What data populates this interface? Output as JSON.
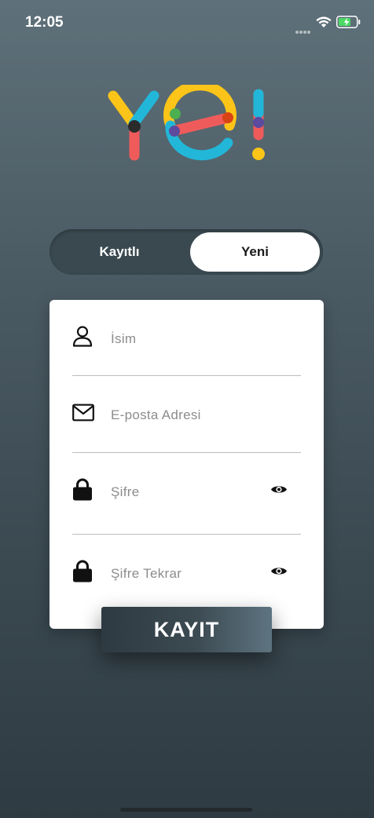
{
  "status_bar": {
    "time": "12:05"
  },
  "logo": {
    "text": "ye!",
    "colors": {
      "yellow": "#fcc419",
      "cyan": "#22b7d8",
      "red": "#ef5b5b",
      "green": "#4caf50",
      "purple": "#5b4a9e",
      "dark": "#2b2b2b"
    }
  },
  "segmented": {
    "options": [
      "Kayıtlı",
      "Yeni"
    ],
    "selected": "Yeni"
  },
  "form": {
    "name_placeholder": "İsim",
    "email_placeholder": "E-posta Adresi",
    "password_placeholder": "Şifre",
    "password_confirm_placeholder": "Şifre Tekrar"
  },
  "submit": {
    "label": "KAYIT"
  }
}
